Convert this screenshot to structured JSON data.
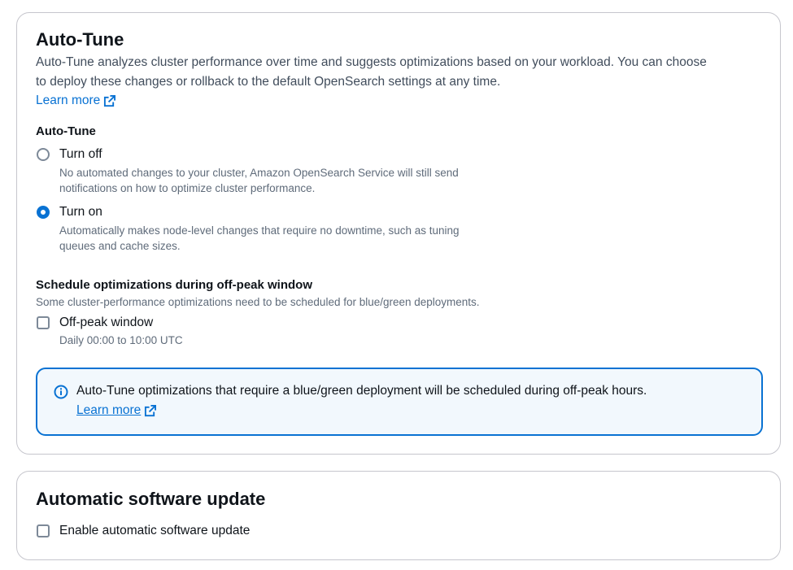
{
  "autotune": {
    "title": "Auto-Tune",
    "description_line1": "Auto-Tune analyzes cluster performance over time and suggests optimizations based on your workload. You can choose",
    "description_line2": "to deploy these changes or rollback to the default OpenSearch settings at any time.",
    "learn_more": "Learn more",
    "field_label": "Auto-Tune",
    "options": [
      {
        "label": "Turn off",
        "selected": false,
        "desc_line1": "No automated changes to your cluster, Amazon OpenSearch Service will still send",
        "desc_line2": "notifications on how to optimize cluster performance."
      },
      {
        "label": "Turn on",
        "selected": true,
        "desc_line1": "Automatically makes node-level changes that require no downtime, such as tuning",
        "desc_line2": "queues and cache sizes."
      }
    ],
    "schedule": {
      "label": "Schedule optimizations during off-peak window",
      "description": "Some cluster-performance optimizations need to be scheduled for blue/green deployments.",
      "checkbox_label": "Off-peak window",
      "checkbox_checked": false,
      "checkbox_desc": "Daily 00:00 to 10:00 UTC"
    },
    "alert": {
      "text": "Auto-Tune optimizations that require a blue/green deployment will be scheduled during off-peak hours.",
      "learn_more": "Learn more",
      "icon": "info-icon"
    }
  },
  "software_update": {
    "title": "Automatic software update",
    "checkbox_label": "Enable automatic software update",
    "checkbox_checked": false
  },
  "colors": {
    "link": "#0972d3",
    "border": "#c6c6cd",
    "alert_bg": "#f2f8fd",
    "text": "#0f141a",
    "secondary_text": "#5f6b7a"
  }
}
